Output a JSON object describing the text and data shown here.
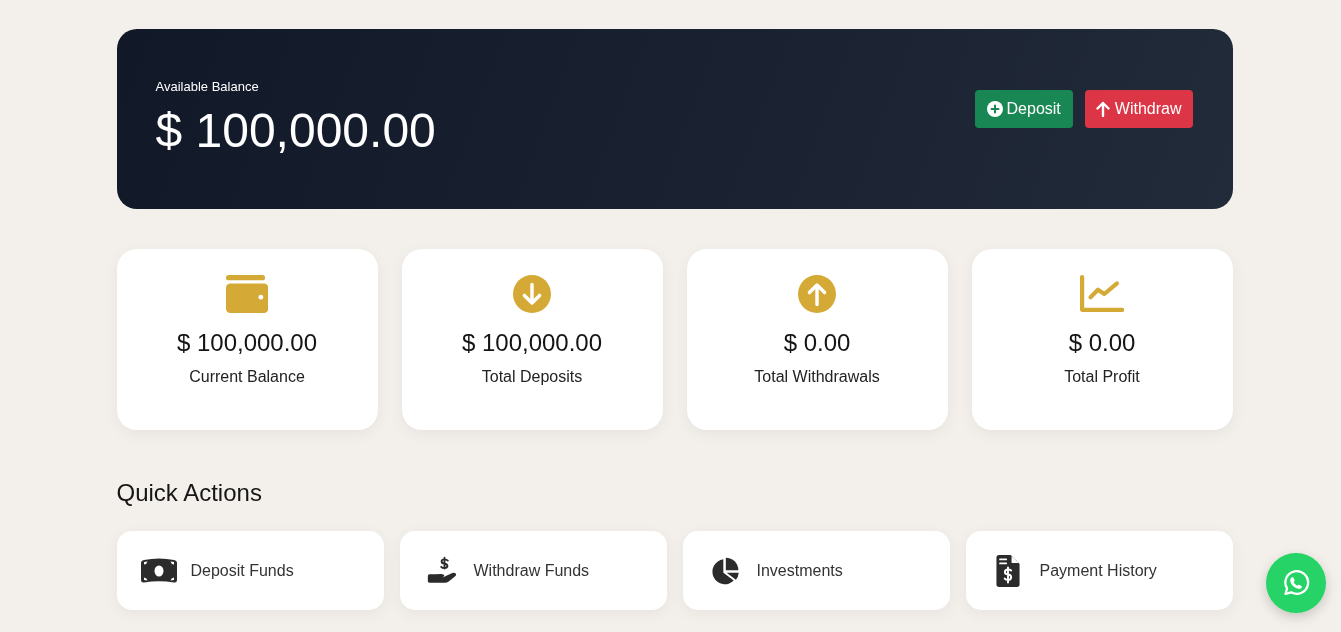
{
  "balance_card": {
    "label": "Available Balance",
    "amount": "$ 100,000.00",
    "buttons": [
      {
        "kind": "deposit",
        "label": "Deposit"
      },
      {
        "kind": "withdraw",
        "label": "Withdraw"
      }
    ]
  },
  "stats": [
    {
      "kind": "balance",
      "amount": "$ 100,000.00",
      "label": "Current Balance"
    },
    {
      "kind": "deposits",
      "amount": "$ 100,000.00",
      "label": "Total Deposits"
    },
    {
      "kind": "withdrawals",
      "amount": "$ 0.00",
      "label": "Total Withdrawals"
    },
    {
      "kind": "profit",
      "amount": "$ 0.00",
      "label": "Total Profit"
    }
  ],
  "quick_actions": {
    "title": "Quick Actions",
    "items": [
      {
        "kind": "deposit",
        "label": "Deposit Funds"
      },
      {
        "kind": "withdraw",
        "label": "Withdraw Funds"
      },
      {
        "kind": "investments",
        "label": "Investments"
      },
      {
        "kind": "history",
        "label": "Payment History"
      }
    ]
  }
}
